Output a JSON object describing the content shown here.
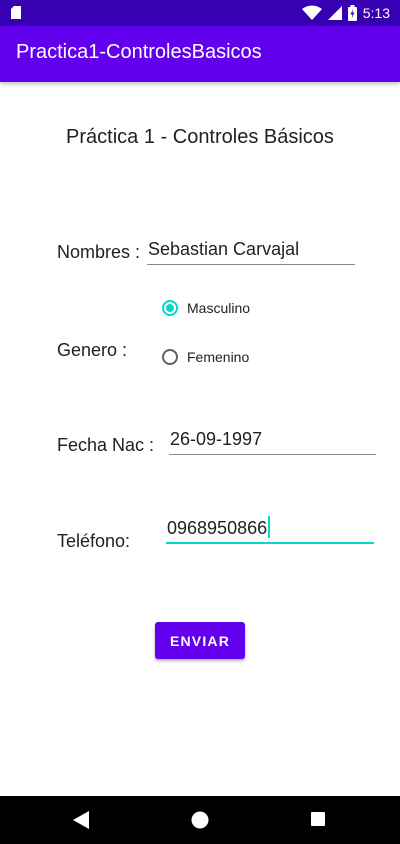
{
  "status_bar": {
    "time": "5:13",
    "icons": [
      "sd-card-icon",
      "wifi-icon",
      "cell-signal-icon",
      "battery-icon"
    ]
  },
  "app_bar": {
    "title": "Practica1-ControlesBasicos"
  },
  "form": {
    "heading": "Práctica 1 - Controles Básicos",
    "nombres": {
      "label": "Nombres :",
      "value": "Sebastian Carvajal"
    },
    "genero": {
      "label": "Genero :",
      "options": [
        {
          "label": "Masculino",
          "checked": true
        },
        {
          "label": "Femenino",
          "checked": false
        }
      ]
    },
    "fecha_nac": {
      "label": "Fecha Nac :",
      "value": "26-09-1997"
    },
    "telefono": {
      "label": "Teléfono:",
      "value": "0968950866"
    },
    "submit_label": "ENVIAR"
  },
  "colors": {
    "status_bar": "#3700b3",
    "app_bar": "#6200ee",
    "accent": "#03dac5",
    "button": "#6200ee"
  },
  "nav_bar": {
    "icons": [
      "back-icon",
      "home-icon",
      "recents-icon"
    ]
  }
}
